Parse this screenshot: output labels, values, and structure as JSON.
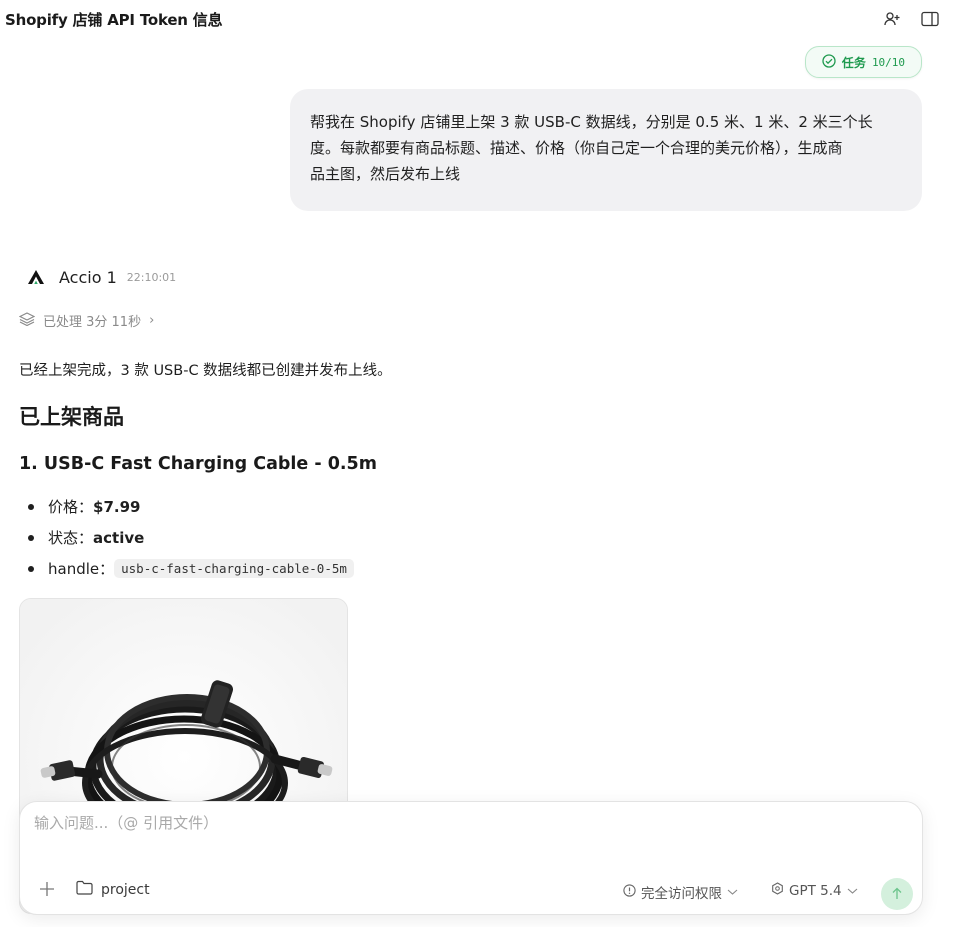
{
  "header": {
    "title": "Shopify 店铺 API Token 信息",
    "icons": [
      "add-user-icon",
      "sidebar-panel-icon"
    ]
  },
  "task_badge": {
    "label": "任务",
    "count": "10/10",
    "icon": "check-circle-icon",
    "color": "#1f9a4f"
  },
  "user_message": {
    "lines": [
      "帮我在 Shopify 店铺里上架 3 款 USB-C 数据线，分别是 0.5 米、1 米、2 米三个长",
      "度。每款都要有商品标题、描述、价格（你自己定一个合理的美元价格），生成商",
      "品主图，然后发布上线"
    ]
  },
  "agent": {
    "name": "Accio 1",
    "time": "22:10:01",
    "icon": "accio-logo-icon"
  },
  "processed": {
    "text": "已处理 3分 11秒",
    "chevron": "›",
    "icon": "layers-icon"
  },
  "response": {
    "intro": "已经上架完成，3 款 USB-C 数据线都已创建并发布上线。",
    "section_title": "已上架商品",
    "product": {
      "title": "1. USB-C Fast Charging Cable - 0.5m",
      "price_label": "价格：",
      "price_value": "$7.99",
      "status_label": "状态：",
      "status_value": "active",
      "handle_label": "handle：",
      "handle_value": "usb-c-fast-charging-cable-0-5m",
      "image_icon": "usb-c-cable-image"
    }
  },
  "composer": {
    "placeholder": "输入问题...（@ 引用文件）",
    "plus_icon": "plus-icon",
    "project_label": "project",
    "access_label": "完全访问权限",
    "model_label": "GPT 5.4",
    "send_icon": "arrow-up-icon",
    "accent": "#d4f0dd"
  }
}
